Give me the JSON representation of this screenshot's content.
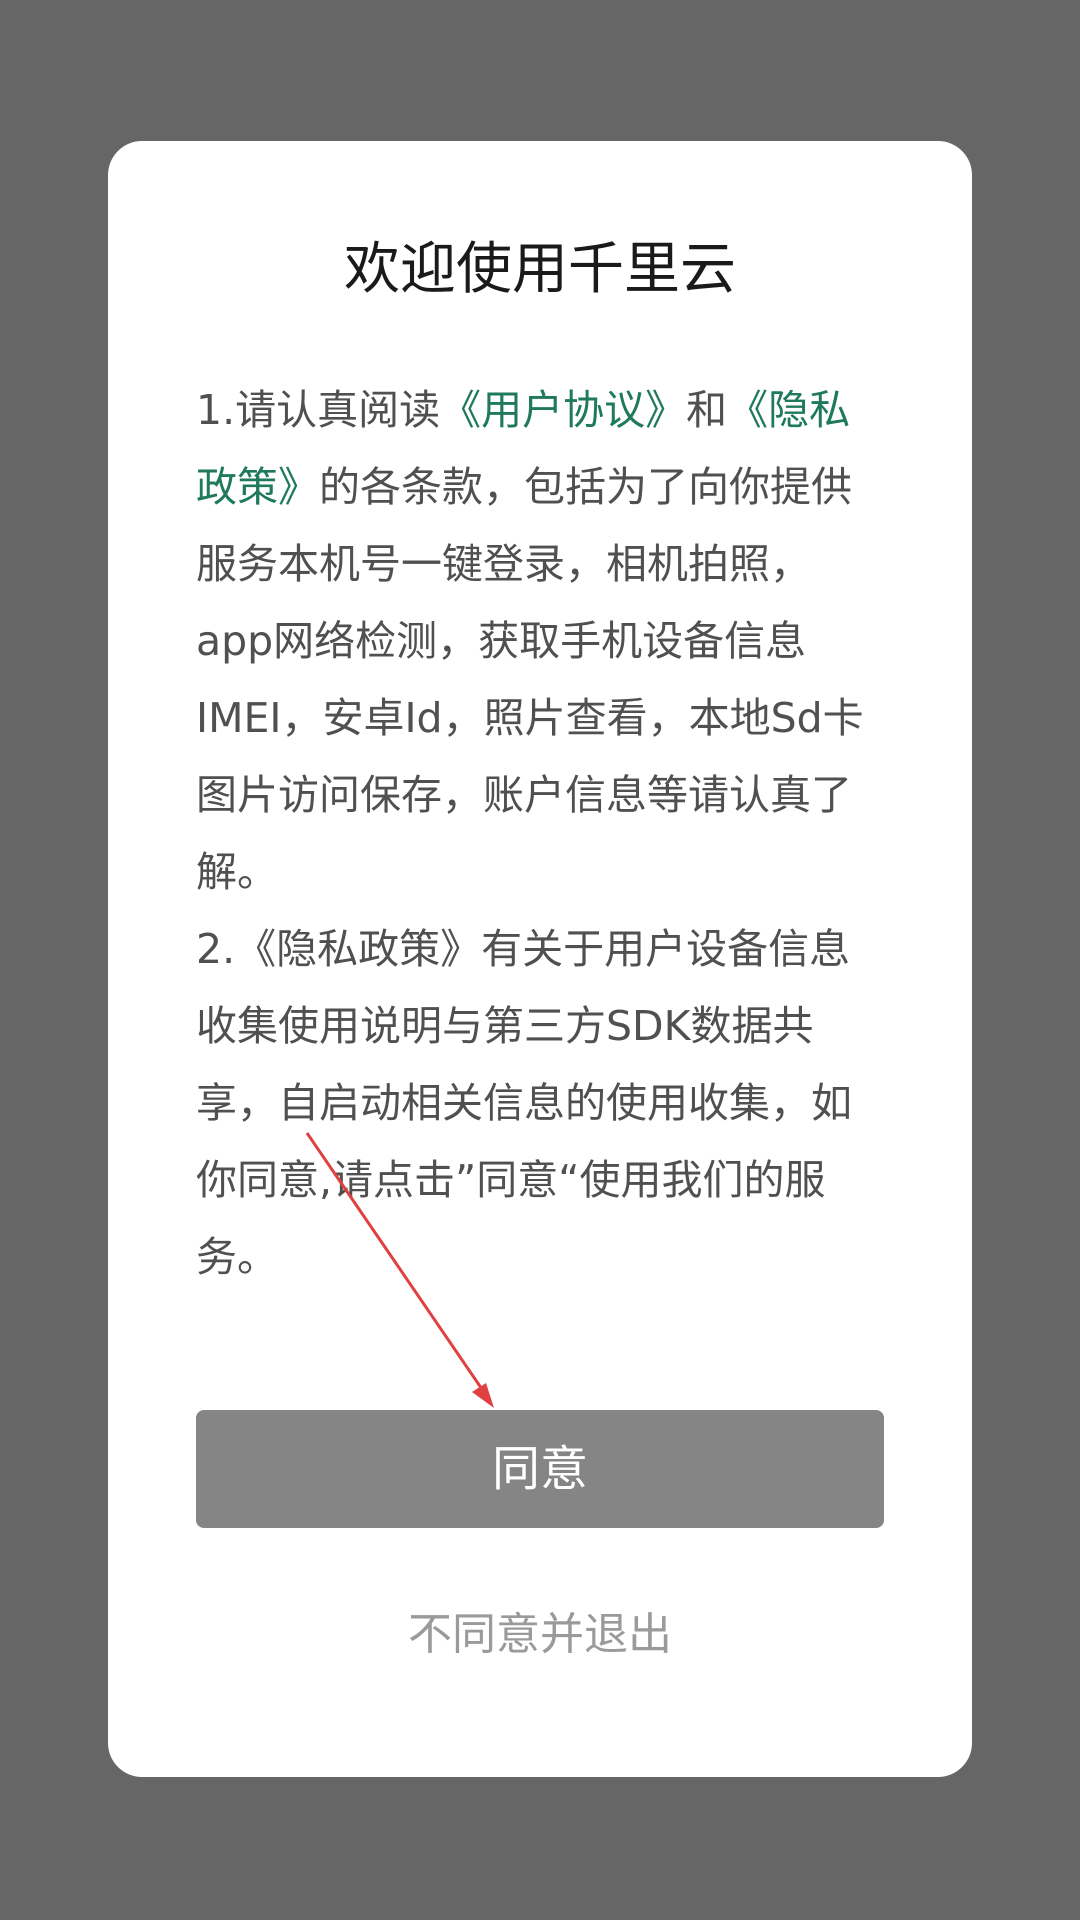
{
  "dialog": {
    "title": "欢迎使用千里云",
    "paragraph1": {
      "prefix": "1.请认真阅读",
      "user_agreement_link": "《用户协议》",
      "conjunction": "和",
      "privacy_policy_link": "《隐私政策》",
      "rest": "的各条款，包括为了向你提供服务本机号一键登录，相机拍照，app网络检测，获取手机设备信息IMEI，安卓Id，照片查看，本地Sd卡图片访问保存，账户信息等请认真了解。"
    },
    "paragraph2": "2.《隐私政策》有关于用户设备信息收集使用说明与第三方SDK数据共享，自启动相关信息的使用收集，如你同意,请点击”同意“使用我们的服务。",
    "agree_button_label": "同意",
    "disagree_link_label": "不同意并退出"
  },
  "colors": {
    "overlay": "#666666",
    "dialog_background": "#ffffff",
    "link": "#1f7a5c",
    "agree_button": "#858585",
    "annotation_arrow": "#e04040"
  },
  "annotation": {
    "type": "arrow",
    "points_to": "agree-button"
  }
}
